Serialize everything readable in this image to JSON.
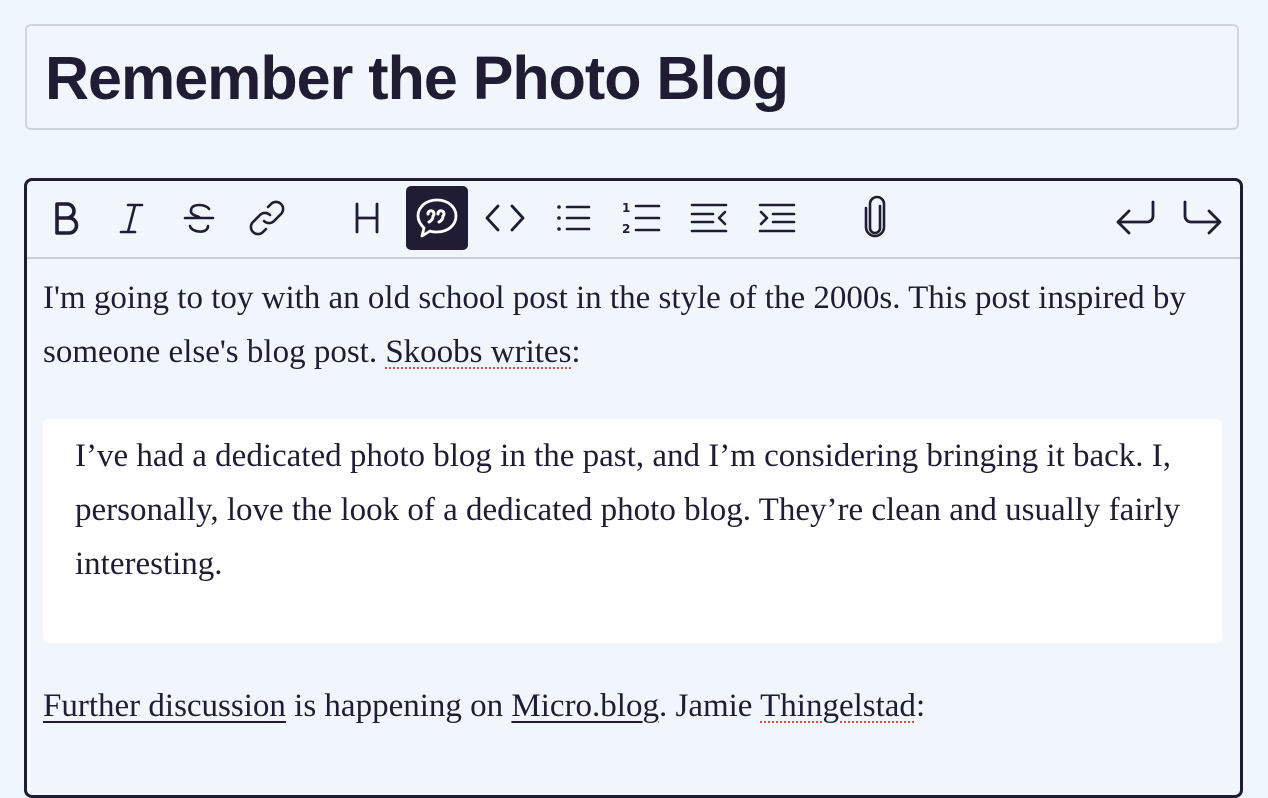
{
  "post": {
    "title": "Remember the Photo Blog"
  },
  "toolbar": {
    "buttons": [
      {
        "name": "bold",
        "icon": "bold-icon",
        "active": false
      },
      {
        "name": "italic",
        "icon": "italic-icon",
        "active": false
      },
      {
        "name": "strikethrough",
        "icon": "strikethrough-icon",
        "active": false
      },
      {
        "name": "link",
        "icon": "link-icon",
        "active": false
      },
      {
        "name": "heading",
        "icon": "heading-icon",
        "active": false
      },
      {
        "name": "quote",
        "icon": "quote-icon",
        "active": true
      },
      {
        "name": "code",
        "icon": "code-icon",
        "active": false
      },
      {
        "name": "bullet-list",
        "icon": "bullet-list-icon",
        "active": false
      },
      {
        "name": "numbered-list",
        "icon": "numbered-list-icon",
        "active": false
      },
      {
        "name": "decrease-indent",
        "icon": "outdent-icon",
        "active": false
      },
      {
        "name": "increase-indent",
        "icon": "indent-icon",
        "active": false
      },
      {
        "name": "attach",
        "icon": "paperclip-icon",
        "active": false
      },
      {
        "name": "undo",
        "icon": "undo-icon",
        "active": false
      },
      {
        "name": "redo",
        "icon": "redo-icon",
        "active": false
      }
    ],
    "active_color": "#201c33"
  },
  "content": {
    "para1_text": "I'm going to toy with an old school post in the style of the 2000s. This post inspired by someone else's blog post. ",
    "para1_link": "Skoobs writes",
    "para1_end": ":",
    "quote_text": "I’ve had a dedicated photo blog in the past, and I’m considering bringing it back. I, personally, love the look of a dedicated photo blog. They’re clean and usually fairly interesting.",
    "para2_link1": "Further discussion",
    "para2_mid": " is happening on ",
    "para2_link2": "Micro.blog",
    "para2_mid2": ". Jamie ",
    "para2_link3": "Thingelstad",
    "para2_end": ":"
  }
}
